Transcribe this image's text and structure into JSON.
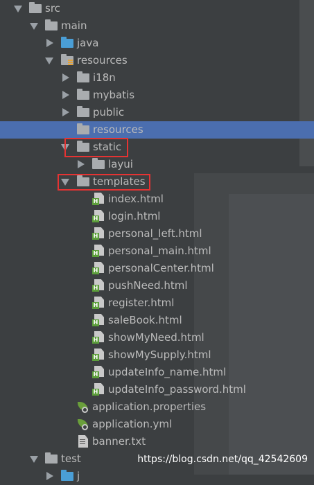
{
  "tree": {
    "src": "src",
    "main": "main",
    "java": "java",
    "resources": "resources",
    "i18n": "i18n",
    "mybatis": "mybatis",
    "public": "public",
    "resources_sub": "resources",
    "static": "static",
    "layui": "layui",
    "templates": "templates",
    "html_files": [
      "index.html",
      "login.html",
      "personal_left.html",
      "personal_main.html",
      "personalCenter.html",
      "pushNeed.html",
      "register.html",
      "saleBook.html",
      "showMyNeed.html",
      "showMySupply.html",
      "updateInfo_name.html",
      "updateInfo_password.html"
    ],
    "application_properties": "application.properties",
    "application_yml": "application.yml",
    "banner_txt": "banner.txt",
    "test": "test",
    "partial_last": "j"
  },
  "watermark": "https://blog.csdn.net/qq_42542609",
  "colors": {
    "background": "#3c3f41",
    "selected_row": "#4b6eaf",
    "highlight_box": "#e53333",
    "source_folder": "#4a9ed6",
    "html_badge": "#5c9e3b"
  }
}
